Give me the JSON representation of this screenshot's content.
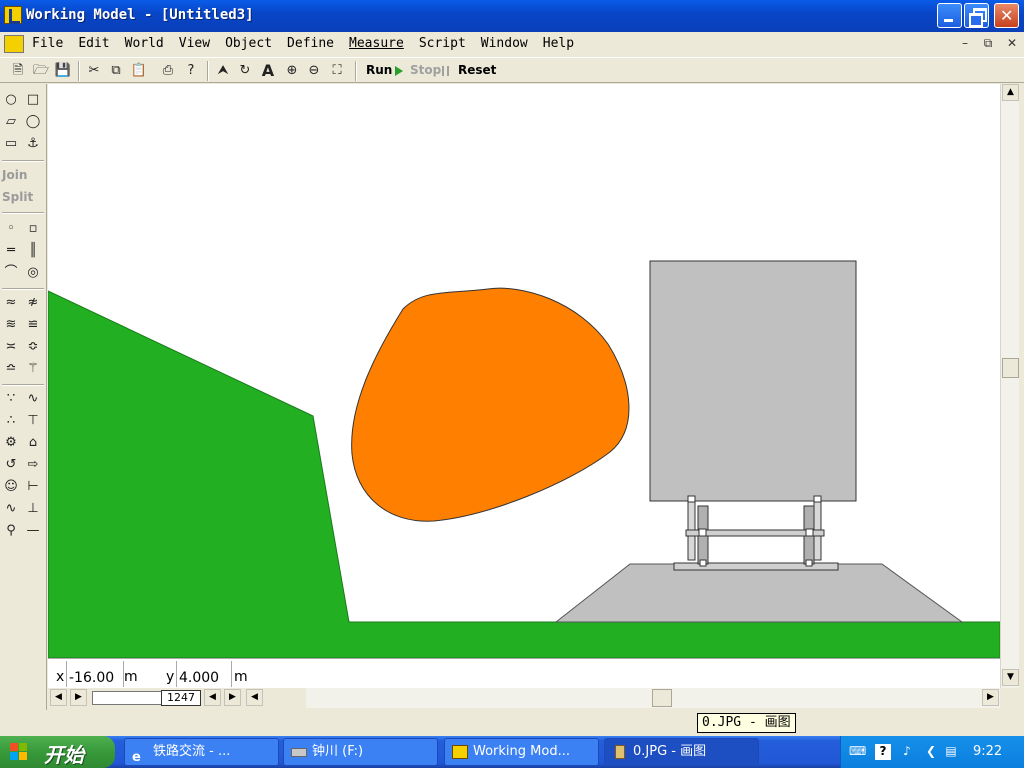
{
  "window": {
    "title": "Working Model - [Untitled3]"
  },
  "menu": {
    "items": [
      "File",
      "Edit",
      "World",
      "View",
      "Object",
      "Define",
      "Measure",
      "Script",
      "Window",
      "Help"
    ],
    "active": "Measure"
  },
  "toolbar": {
    "run_label": "Run",
    "stop_label": "Stop",
    "reset_label": "Reset"
  },
  "palette": {
    "join_label": "Join",
    "split_label": "Split"
  },
  "coords": {
    "x_label": "x",
    "x_value": "-16.00",
    "x_unit": "m",
    "y_label": "y",
    "y_value": "4.000",
    "y_unit": "m"
  },
  "frames": {
    "count": "1247"
  },
  "tooltip": {
    "text": "0.JPG - 画图"
  },
  "taskbar": {
    "start_label": "开始",
    "tasks": [
      {
        "label": "铁路交流 - ..."
      },
      {
        "label": "钟川 (F:)"
      },
      {
        "label": "Working Mod..."
      },
      {
        "label": "0.JPG - 画图"
      }
    ],
    "clock": "9:22"
  },
  "colors": {
    "ground": "#22b022",
    "blob": "#ff7f00",
    "body": "#c0c0c0",
    "workspace": "#ffffff"
  }
}
